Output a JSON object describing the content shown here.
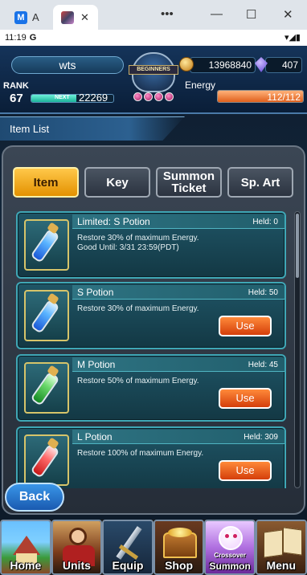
{
  "browser": {
    "tab1_label": "A",
    "tab1_logo": "M",
    "tab2_label": "",
    "more_label": "•••",
    "minimize_label": "—",
    "maximize_label": "☐",
    "close_label": "✕"
  },
  "status_bar": {
    "time": "11:19",
    "icons": "G",
    "right_icons": "▾◢▮"
  },
  "hud": {
    "player_name": "wts",
    "rank_label": "RANK",
    "rank": "67",
    "next_label": "NEXT",
    "next_exp": "22269",
    "exp_progress": 0.55,
    "zel": "13968840",
    "lacrima": "407",
    "energy_label": "Energy",
    "energy": "112/112",
    "energy_progress": 1.0,
    "emblem_text": "BEGINNERS"
  },
  "section_title": "Item List",
  "tabs": [
    {
      "label": "Item",
      "active": true
    },
    {
      "label": "Key",
      "active": false
    },
    {
      "label": "Summon Ticket",
      "active": false
    },
    {
      "label": "Sp. Art",
      "active": false
    }
  ],
  "items": [
    {
      "name": "Limited: S Potion",
      "held": "Held: 0",
      "description": "Restore 30% of maximum Energy. Good Until: 3/31 23:59(PDT)",
      "color": "blue",
      "use_label": ""
    },
    {
      "name": "S Potion",
      "held": "Held: 50",
      "description": "Restore 30% of maximum Energy.",
      "color": "blue",
      "use_label": "Use"
    },
    {
      "name": "M Potion",
      "held": "Held: 45",
      "description": "Restore 50% of maximum Energy.",
      "color": "green",
      "use_label": "Use"
    },
    {
      "name": "L Potion",
      "held": "Held: 309",
      "description": "Restore 100% of maximum Energy.",
      "color": "red",
      "use_label": "Use"
    }
  ],
  "back_label": "Back",
  "nav": [
    {
      "label": "Home",
      "sub": "",
      "icon": "house-icon"
    },
    {
      "label": "Units",
      "sub": "",
      "icon": "hero-icon"
    },
    {
      "label": "Equip",
      "sub": "",
      "icon": "sword-icon"
    },
    {
      "label": "Shop",
      "sub": "",
      "icon": "treasure-chest-icon"
    },
    {
      "label": "Summon",
      "sub": "Crossover",
      "icon": "summon-crystal-icon"
    },
    {
      "label": "Menu",
      "sub": "",
      "icon": "book-icon"
    }
  ],
  "colors": {
    "active_tab": "#f0a820",
    "use_button": "#e8561a",
    "card_border": "#3fa7b6",
    "energy_fill": "#f07a30",
    "exp_fill": "#3ad6bb"
  }
}
